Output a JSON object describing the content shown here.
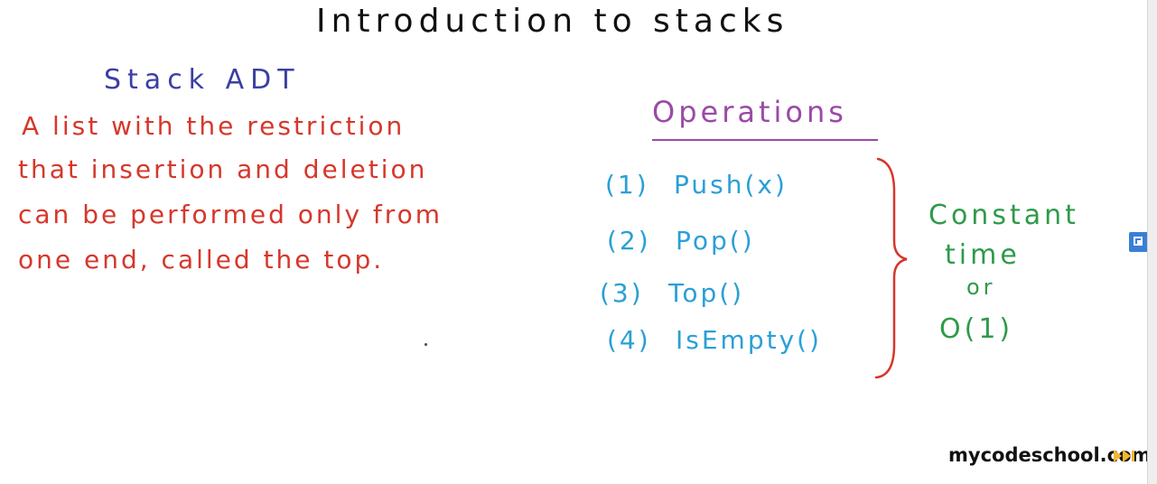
{
  "title": "Introduction to stacks",
  "definition": {
    "heading": "Stack ADT",
    "lines": [
      "A list with the restriction",
      "that insertion and deletion",
      "can be performed only from",
      "one end, called the top."
    ]
  },
  "operations": {
    "heading": "Operations",
    "items": [
      {
        "number": "(1)",
        "name": "Push(x)"
      },
      {
        "number": "(2)",
        "name": "Pop()"
      },
      {
        "number": "(3)",
        "name": "Top()"
      },
      {
        "number": "(4)",
        "name": "IsEmpty()"
      }
    ]
  },
  "complexity": {
    "lines": [
      "Constant",
      "time",
      "or",
      "O(1)"
    ]
  },
  "watermark": "mycodeschool.com",
  "colors": {
    "title": "#111111",
    "adt_heading": "#3b3fa3",
    "definition": "#d6372b",
    "operations_heading": "#9a4aa6",
    "operations": "#2a9fd6",
    "brace": "#d6372b",
    "complexity": "#2f9a4a"
  },
  "icons": {
    "side": "window-overlay-icon",
    "watermark_logo": "mycodeschool-logo-icon"
  }
}
